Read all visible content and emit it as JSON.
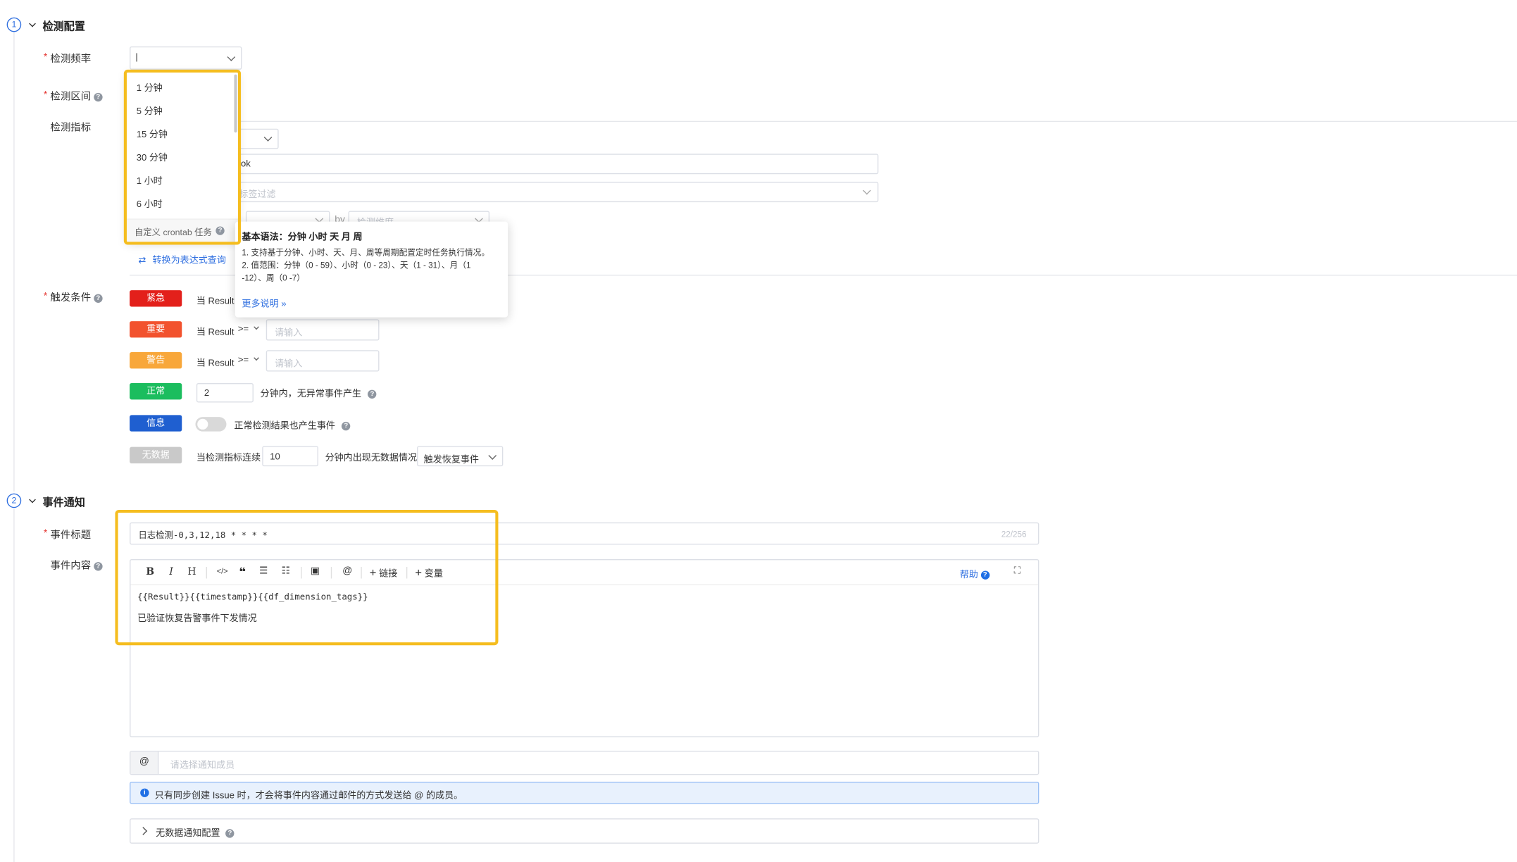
{
  "detection_config": {
    "step": "1",
    "title": "检测配置",
    "frequency_label": "检测频率",
    "frequency_value": "|",
    "range_label": "检测区间",
    "metrics_label": "检测指标",
    "metric_text_suffix": "ok",
    "tag_filter_placeholder": "标签过滤",
    "by_label": "by",
    "dimension_placeholder": "检测维度",
    "convert_link": "转换为表达式查询"
  },
  "frequency_dropdown": {
    "options": [
      "1 分钟",
      "5 分钟",
      "15 分钟",
      "30 分钟",
      "1 小时",
      "6 小时"
    ],
    "custom_label": "自定义 crontab 任务"
  },
  "crontab_tooltip": {
    "title": "基本语法：分钟 小时 天 月 周",
    "line1": "1. 支持基于分钟、小时、天、月、周等周期配置定时任务执行情况。",
    "line2a": "2. 值范围：分钟（0 - 59）、小时（0 - 23）、天（1 - 31）、月（1",
    "line2b": "-12）、周（0 -7）",
    "more_link": "更多说明"
  },
  "trigger": {
    "label": "触发条件",
    "critical": {
      "tag": "紧急",
      "prefix": "当 Result"
    },
    "important": {
      "tag": "重要",
      "prefix": "当 Result",
      "op": ">=",
      "placeholder": "请输入"
    },
    "warning": {
      "tag": "警告",
      "prefix": "当 Result",
      "op": ">=",
      "placeholder": "请输入"
    },
    "normal": {
      "tag": "正常",
      "value": "2",
      "suffix": "分钟内，无异常事件产生"
    },
    "info": {
      "tag": "信息",
      "toggle_label": "正常检测结果也产生事件"
    },
    "nodata": {
      "tag": "无数据",
      "prefix": "当检测指标连续",
      "value": "10",
      "suffix": "分钟内出现无数据情况",
      "select": "触发恢复事件"
    }
  },
  "event_notify": {
    "step": "2",
    "title": "事件通知",
    "title_label": "事件标题",
    "title_value": "日志检测-0,3,12,18 * * * *",
    "title_count": "22/256",
    "content_label": "事件内容",
    "toolbar": {
      "bold": "B",
      "italic": "I",
      "heading": "H",
      "link": "链接",
      "variable": "变量",
      "help": "帮助"
    },
    "content_line1": "{{Result}}{{timestamp}}{{df_dimension_tags}}",
    "content_line2": "已验证恢复告警事件下发情况",
    "at_symbol": "@",
    "members_placeholder": "请选择通知成员",
    "info_notice": "只有同步创建 Issue 时，才会将事件内容通过邮件的方式发送给 @ 的成员。",
    "nodata_notify": "无数据通知配置"
  },
  "colors": {
    "critical": "#e3201b",
    "important": "#f2522e",
    "warning": "#f8a73a",
    "normal": "#1bbd5e",
    "info": "#1f5fd0",
    "nodata": "#c9c9c9",
    "highlight": "#f5bd1f",
    "link": "#2f6fe0"
  }
}
